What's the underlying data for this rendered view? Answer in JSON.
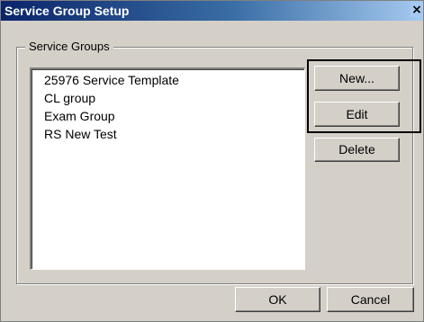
{
  "window": {
    "title": "Service Group Setup",
    "close_glyph": "×"
  },
  "groupbox": {
    "label": "Service Groups"
  },
  "service_groups": [
    "25976 Service Template",
    "CL group",
    "Exam Group",
    "RS New Test"
  ],
  "buttons": {
    "new": "New...",
    "edit": "Edit",
    "delete": "Delete",
    "ok": "OK",
    "cancel": "Cancel"
  },
  "colors": {
    "title_bar_start": "#0a246a",
    "title_bar_end": "#a6caf0",
    "dialog_face": "#d4d0c8"
  },
  "icons": {
    "close": "close-icon"
  }
}
